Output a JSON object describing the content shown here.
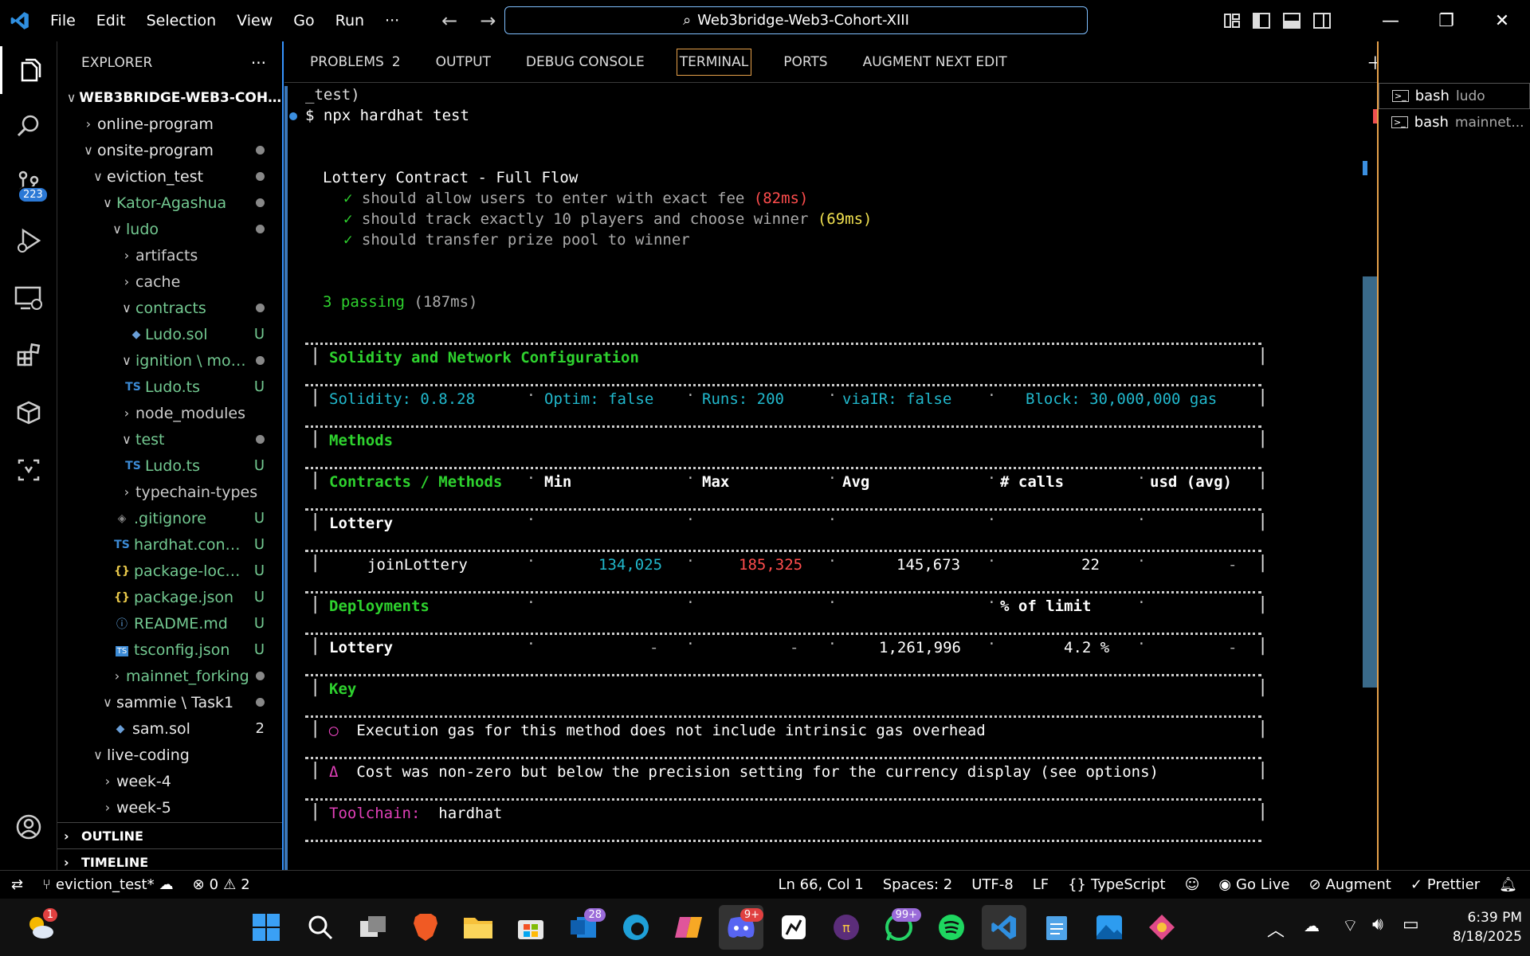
{
  "menu": [
    "File",
    "Edit",
    "Selection",
    "View",
    "Go",
    "Run",
    "···"
  ],
  "search": {
    "text": "Web3bridge-Web3-Cohort-XIII"
  },
  "activity": {
    "scm_badge": "223"
  },
  "explorer": {
    "title": "EXPLORER",
    "root": "WEB3BRIDGE-WEB3-COHORT...",
    "items": [
      {
        "label": "online-program",
        "status": ""
      },
      {
        "label": "onsite-program",
        "status": ""
      },
      {
        "label": "eviction_test",
        "status": ""
      },
      {
        "label": "Kator-Agashua",
        "status": ""
      },
      {
        "label": "ludo",
        "status": ""
      },
      {
        "label": "artifacts",
        "status": ""
      },
      {
        "label": "cache",
        "status": ""
      },
      {
        "label": "contracts",
        "status": ""
      },
      {
        "label": "Ludo.sol",
        "status": "U"
      },
      {
        "label": "ignition \\ mod...",
        "status": ""
      },
      {
        "label": "Ludo.ts",
        "status": "U"
      },
      {
        "label": "node_modules",
        "status": ""
      },
      {
        "label": "test",
        "status": ""
      },
      {
        "label": "Ludo.ts",
        "status": "U"
      },
      {
        "label": "typechain-types",
        "status": ""
      },
      {
        "label": ".gitignore",
        "status": "U"
      },
      {
        "label": "hardhat.config...",
        "status": "U"
      },
      {
        "label": "package-lock.j...",
        "status": "U"
      },
      {
        "label": "package.json",
        "status": "U"
      },
      {
        "label": "README.md",
        "status": "U"
      },
      {
        "label": "tsconfig.json",
        "status": "U"
      },
      {
        "label": "mainnet_forking",
        "status": ""
      },
      {
        "label": "sammie \\ Task1",
        "status": ""
      },
      {
        "label": "sam.sol",
        "status": "2"
      },
      {
        "label": "live-coding",
        "status": ""
      },
      {
        "label": "week-4",
        "status": ""
      },
      {
        "label": "week-5",
        "status": ""
      }
    ],
    "outline": "OUTLINE",
    "timeline": "TIMELINE"
  },
  "tabs": {
    "problems": "PROBLEMS",
    "problems_count": "2",
    "output": "OUTPUT",
    "debug": "DEBUG CONSOLE",
    "terminal": "TERMINAL",
    "ports": "PORTS",
    "augment": "AUGMENT NEXT EDIT"
  },
  "terminal": {
    "l0": "_test)",
    "l1": "$ npx hardhat test",
    "suite": "Lottery Contract - Full Flow",
    "t1": "should allow users to enter with exact fee",
    "t1time": "(82ms)",
    "t2": "should track exactly 10 players and choose winner",
    "t2time": "(69ms)",
    "t3": "should transfer prize pool to winner",
    "pass": "3 passing",
    "passtime": "(187ms)",
    "cfg_title": "Solidity and Network Configuration",
    "solidity": "Solidity: 0.8.28",
    "optim": "Optim: false",
    "runs": "Runs: 200",
    "viair": "viaIR: false",
    "block": "Block: 30,000,000 gas",
    "methods": "Methods",
    "h_cm": "Contracts / Methods",
    "h_min": "Min",
    "h_max": "Max",
    "h_avg": "Avg",
    "h_calls": "# calls",
    "h_usd": "usd (avg)",
    "lottery": "Lottery",
    "join": "joinLottery",
    "j_min": "134,025",
    "j_max": "185,325",
    "j_avg": "145,673",
    "j_calls": "22",
    "j_usd": "-",
    "deployments": "Deployments",
    "pct": "% of limit",
    "d_name": "Lottery",
    "d_min": "-",
    "d_max": "-",
    "d_avg": "1,261,996",
    "d_pct": "4.2 %",
    "d_usd": "-",
    "key": "Key",
    "k1sym": "◯",
    "k1": "Execution gas for this method does not include intrinsic gas overhead",
    "k2sym": "Δ",
    "k2": "Cost was non-zero but below the precision setting for the currency display (see options)",
    "toolchain": "Toolchain:",
    "tool": "hardhat"
  },
  "terminals": [
    {
      "name": "bash",
      "sub": "ludo"
    },
    {
      "name": "bash",
      "sub": "mainnet..."
    }
  ],
  "status": {
    "branch": "eviction_test*",
    "errors": "0",
    "warnings": "2",
    "pos": "Ln 66, Col 1",
    "spaces": "Spaces: 2",
    "enc": "UTF-8",
    "eol": "LF",
    "lang": "TypeScript",
    "live": "Go Live",
    "augment": "Augment",
    "prettier": "Prettier"
  },
  "taskbar": {
    "weather_badge": "1",
    "b1": "28",
    "b2": "9+",
    "b3": "99+",
    "time": "6:39 PM",
    "date": "8/18/2025"
  },
  "colors": {
    "accent": "#3794ff",
    "green": "#2ed22e",
    "cyan": "#21b8cc",
    "red": "#ff4d4d"
  }
}
